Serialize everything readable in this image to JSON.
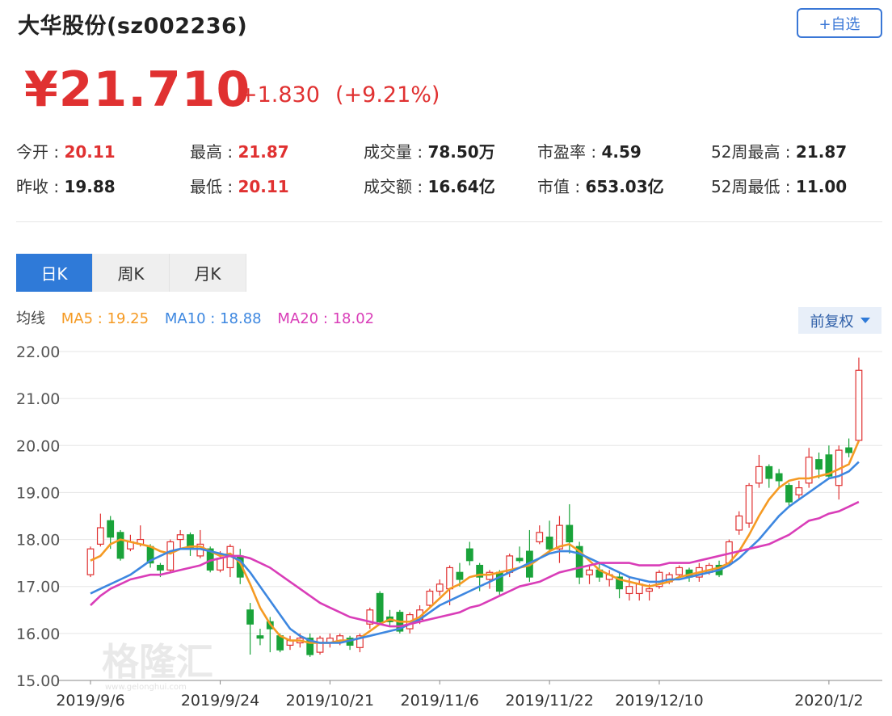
{
  "header": {
    "title": "大华股份(sz002236)",
    "add_label": "+自选"
  },
  "quote": {
    "price": "¥21.710",
    "change": "+1.830",
    "change_pct": "(+9.21%)"
  },
  "stats": {
    "open_label": "今开 : ",
    "open": "20.11",
    "prev_close_label": "昨收 : ",
    "prev_close": "19.88",
    "high_label": "最高 : ",
    "high": "21.87",
    "low_label": "最低 : ",
    "low": "20.11",
    "volume_label": "成交量 : ",
    "volume": "78.50万",
    "amount_label": "成交额 : ",
    "amount": "16.64亿",
    "pe_label": "市盈率 : ",
    "pe": "4.59",
    "mcap_label": "市值 : ",
    "mcap": "653.03亿",
    "w52_high_label": "52周最高 : ",
    "w52_high": "21.87",
    "w52_low_label": "52周最低 : ",
    "w52_low": "11.00"
  },
  "tabs": [
    "日K",
    "周K",
    "月K"
  ],
  "ma": {
    "label": "均线",
    "ma5": "MA5 : 19.25",
    "ma10": "MA10 : 18.88",
    "ma20": "MA20 : 18.02"
  },
  "adjust_label": "前复权",
  "watermark": "格隆汇",
  "watermark_url": "www.gelonghui.com",
  "colors": {
    "up": "#e03131",
    "down": "#1aa33a",
    "ma5": "#f59a23",
    "ma10": "#3d87e0",
    "ma20": "#d93db8",
    "accent": "#2f7ad8"
  },
  "chart_data": {
    "type": "candlestick",
    "ylim": [
      15.0,
      22.0
    ],
    "yticks": [
      "22.00",
      "21.00",
      "20.00",
      "19.00",
      "18.00",
      "17.00",
      "16.00",
      "15.00"
    ],
    "xticks": [
      "2019/9/6",
      "2019/9/24",
      "2019/10/21",
      "2019/11/6",
      "2019/11/22",
      "2019/12/10",
      "2020/1/2"
    ],
    "xtick_index": [
      0,
      13,
      24,
      35,
      46,
      57,
      74
    ],
    "candles": [
      {
        "o": 17.25,
        "c": 17.8,
        "h": 17.85,
        "l": 17.2
      },
      {
        "o": 17.9,
        "c": 18.25,
        "h": 18.55,
        "l": 17.85
      },
      {
        "o": 18.4,
        "c": 18.05,
        "h": 18.5,
        "l": 17.8
      },
      {
        "o": 18.15,
        "c": 17.6,
        "h": 18.2,
        "l": 17.55
      },
      {
        "o": 17.8,
        "c": 17.95,
        "h": 18.1,
        "l": 17.75
      },
      {
        "o": 17.9,
        "c": 18.0,
        "h": 18.3,
        "l": 17.85
      },
      {
        "o": 17.85,
        "c": 17.5,
        "h": 17.9,
        "l": 17.4
      },
      {
        "o": 17.45,
        "c": 17.35,
        "h": 17.5,
        "l": 17.2
      },
      {
        "o": 17.35,
        "c": 17.95,
        "h": 18.0,
        "l": 17.3
      },
      {
        "o": 18.0,
        "c": 18.1,
        "h": 18.2,
        "l": 17.8
      },
      {
        "o": 18.1,
        "c": 17.8,
        "h": 18.15,
        "l": 17.65
      },
      {
        "o": 17.65,
        "c": 17.9,
        "h": 18.2,
        "l": 17.6
      },
      {
        "o": 17.8,
        "c": 17.35,
        "h": 17.85,
        "l": 17.3
      },
      {
        "o": 17.35,
        "c": 17.6,
        "h": 17.75,
        "l": 17.3
      },
      {
        "o": 17.4,
        "c": 17.85,
        "h": 17.9,
        "l": 17.2
      },
      {
        "o": 17.65,
        "c": 17.2,
        "h": 17.8,
        "l": 17.05
      },
      {
        "o": 16.5,
        "c": 16.2,
        "h": 16.65,
        "l": 15.55
      },
      {
        "o": 15.95,
        "c": 15.9,
        "h": 16.1,
        "l": 15.75
      },
      {
        "o": 16.25,
        "c": 16.1,
        "h": 16.35,
        "l": 15.6
      },
      {
        "o": 15.95,
        "c": 15.65,
        "h": 16.0,
        "l": 15.6
      },
      {
        "o": 15.75,
        "c": 15.85,
        "h": 15.95,
        "l": 15.65
      },
      {
        "o": 15.8,
        "c": 15.9,
        "h": 16.0,
        "l": 15.7
      },
      {
        "o": 15.9,
        "c": 15.55,
        "h": 16.0,
        "l": 15.5
      },
      {
        "o": 15.6,
        "c": 15.9,
        "h": 15.95,
        "l": 15.55
      },
      {
        "o": 15.8,
        "c": 15.9,
        "h": 16.0,
        "l": 15.7
      },
      {
        "o": 15.85,
        "c": 15.95,
        "h": 16.0,
        "l": 15.75
      },
      {
        "o": 15.9,
        "c": 15.75,
        "h": 15.95,
        "l": 15.65
      },
      {
        "o": 15.7,
        "c": 15.95,
        "h": 16.0,
        "l": 15.6
      },
      {
        "o": 16.2,
        "c": 16.5,
        "h": 16.55,
        "l": 16.1
      },
      {
        "o": 16.85,
        "c": 16.25,
        "h": 16.9,
        "l": 16.2
      },
      {
        "o": 16.35,
        "c": 16.25,
        "h": 16.5,
        "l": 16.15
      },
      {
        "o": 16.45,
        "c": 16.05,
        "h": 16.5,
        "l": 16.0
      },
      {
        "o": 16.1,
        "c": 16.4,
        "h": 16.45,
        "l": 16.0
      },
      {
        "o": 16.3,
        "c": 16.5,
        "h": 16.6,
        "l": 16.2
      },
      {
        "o": 16.6,
        "c": 16.9,
        "h": 16.95,
        "l": 16.55
      },
      {
        "o": 16.9,
        "c": 17.05,
        "h": 17.15,
        "l": 16.8
      },
      {
        "o": 16.95,
        "c": 17.4,
        "h": 17.45,
        "l": 16.6
      },
      {
        "o": 17.3,
        "c": 17.15,
        "h": 17.5,
        "l": 17.0
      },
      {
        "o": 17.8,
        "c": 17.55,
        "h": 17.95,
        "l": 17.45
      },
      {
        "o": 17.45,
        "c": 17.2,
        "h": 17.5,
        "l": 16.9
      },
      {
        "o": 17.15,
        "c": 17.3,
        "h": 17.35,
        "l": 16.95
      },
      {
        "o": 17.3,
        "c": 16.9,
        "h": 17.35,
        "l": 16.8
      },
      {
        "o": 17.3,
        "c": 17.65,
        "h": 17.7,
        "l": 17.2
      },
      {
        "o": 17.6,
        "c": 17.55,
        "h": 17.85,
        "l": 17.5
      },
      {
        "o": 17.75,
        "c": 17.2,
        "h": 18.2,
        "l": 17.1
      },
      {
        "o": 17.95,
        "c": 18.15,
        "h": 18.3,
        "l": 17.9
      },
      {
        "o": 18.05,
        "c": 17.8,
        "h": 18.4,
        "l": 17.7
      },
      {
        "o": 17.8,
        "c": 18.3,
        "h": 18.5,
        "l": 17.5
      },
      {
        "o": 18.3,
        "c": 17.95,
        "h": 18.75,
        "l": 17.7
      },
      {
        "o": 17.85,
        "c": 17.2,
        "h": 17.95,
        "l": 17.05
      },
      {
        "o": 17.25,
        "c": 17.35,
        "h": 17.45,
        "l": 17.05
      },
      {
        "o": 17.35,
        "c": 17.2,
        "h": 17.5,
        "l": 17.1
      },
      {
        "o": 17.15,
        "c": 17.25,
        "h": 17.35,
        "l": 17.0
      },
      {
        "o": 17.2,
        "c": 16.95,
        "h": 17.3,
        "l": 16.75
      },
      {
        "o": 16.85,
        "c": 17.0,
        "h": 17.2,
        "l": 16.7
      },
      {
        "o": 16.85,
        "c": 17.05,
        "h": 17.15,
        "l": 16.7
      },
      {
        "o": 16.9,
        "c": 16.95,
        "h": 17.05,
        "l": 16.7
      },
      {
        "o": 17.0,
        "c": 17.3,
        "h": 17.35,
        "l": 16.95
      },
      {
        "o": 17.1,
        "c": 17.25,
        "h": 17.3,
        "l": 17.05
      },
      {
        "o": 17.25,
        "c": 17.4,
        "h": 17.45,
        "l": 17.2
      },
      {
        "o": 17.35,
        "c": 17.2,
        "h": 17.4,
        "l": 17.1
      },
      {
        "o": 17.2,
        "c": 17.4,
        "h": 17.5,
        "l": 17.1
      },
      {
        "o": 17.3,
        "c": 17.45,
        "h": 17.5,
        "l": 17.25
      },
      {
        "o": 17.45,
        "c": 17.25,
        "h": 17.55,
        "l": 17.2
      },
      {
        "o": 17.5,
        "c": 17.95,
        "h": 18.0,
        "l": 17.45
      },
      {
        "o": 18.2,
        "c": 18.5,
        "h": 18.6,
        "l": 18.1
      },
      {
        "o": 18.35,
        "c": 19.15,
        "h": 19.2,
        "l": 18.25
      },
      {
        "o": 19.2,
        "c": 19.55,
        "h": 19.8,
        "l": 19.1
      },
      {
        "o": 19.55,
        "c": 19.3,
        "h": 19.6,
        "l": 19.1
      },
      {
        "o": 19.4,
        "c": 19.25,
        "h": 19.5,
        "l": 19.1
      },
      {
        "o": 19.15,
        "c": 18.8,
        "h": 19.2,
        "l": 18.7
      },
      {
        "o": 18.95,
        "c": 19.1,
        "h": 19.25,
        "l": 18.85
      },
      {
        "o": 19.2,
        "c": 19.75,
        "h": 19.95,
        "l": 19.1
      },
      {
        "o": 19.7,
        "c": 19.5,
        "h": 19.85,
        "l": 19.3
      },
      {
        "o": 19.8,
        "c": 19.35,
        "h": 20.0,
        "l": 19.3
      },
      {
        "o": 19.15,
        "c": 19.9,
        "h": 20.0,
        "l": 18.85
      },
      {
        "o": 19.95,
        "c": 19.85,
        "h": 20.15,
        "l": 19.75
      },
      {
        "o": 20.11,
        "c": 21.6,
        "h": 21.87,
        "l": 20.11
      }
    ],
    "ma5": [
      17.55,
      17.65,
      17.9,
      18.0,
      17.95,
      17.9,
      17.85,
      17.75,
      17.7,
      17.8,
      17.85,
      17.85,
      17.75,
      17.65,
      17.7,
      17.5,
      17.05,
      16.55,
      16.2,
      15.95,
      15.85,
      15.85,
      15.8,
      15.8,
      15.8,
      15.85,
      15.85,
      15.9,
      16.05,
      16.2,
      16.3,
      16.25,
      16.25,
      16.35,
      16.55,
      16.75,
      16.95,
      17.05,
      17.2,
      17.25,
      17.25,
      17.3,
      17.35,
      17.4,
      17.45,
      17.6,
      17.75,
      17.85,
      17.9,
      17.75,
      17.55,
      17.35,
      17.25,
      17.15,
      17.1,
      17.05,
      17.0,
      17.05,
      17.1,
      17.2,
      17.25,
      17.3,
      17.35,
      17.4,
      17.5,
      17.75,
      18.1,
      18.5,
      18.85,
      19.1,
      19.25,
      19.3,
      19.3,
      19.35,
      19.4,
      19.5,
      19.6,
      20.1
    ],
    "ma10": [
      16.85,
      16.95,
      17.05,
      17.15,
      17.25,
      17.4,
      17.55,
      17.65,
      17.75,
      17.8,
      17.8,
      17.8,
      17.75,
      17.7,
      17.65,
      17.55,
      17.3,
      17.0,
      16.7,
      16.4,
      16.1,
      15.95,
      15.85,
      15.8,
      15.8,
      15.8,
      15.85,
      15.9,
      15.95,
      16.0,
      16.05,
      16.1,
      16.2,
      16.3,
      16.45,
      16.6,
      16.7,
      16.8,
      16.9,
      17.0,
      17.1,
      17.2,
      17.3,
      17.4,
      17.5,
      17.6,
      17.7,
      17.75,
      17.75,
      17.7,
      17.6,
      17.5,
      17.4,
      17.3,
      17.2,
      17.15,
      17.1,
      17.1,
      17.15,
      17.15,
      17.2,
      17.25,
      17.3,
      17.35,
      17.45,
      17.6,
      17.8,
      18.0,
      18.25,
      18.5,
      18.7,
      18.85,
      19.0,
      19.15,
      19.3,
      19.35,
      19.45,
      19.65
    ],
    "ma20": [
      16.6,
      16.8,
      16.95,
      17.05,
      17.15,
      17.2,
      17.25,
      17.25,
      17.3,
      17.35,
      17.4,
      17.45,
      17.55,
      17.6,
      17.65,
      17.65,
      17.6,
      17.5,
      17.4,
      17.25,
      17.1,
      16.95,
      16.8,
      16.65,
      16.55,
      16.45,
      16.35,
      16.3,
      16.25,
      16.2,
      16.15,
      16.15,
      16.2,
      16.25,
      16.3,
      16.35,
      16.4,
      16.45,
      16.55,
      16.6,
      16.7,
      16.8,
      16.9,
      17.0,
      17.05,
      17.1,
      17.2,
      17.3,
      17.35,
      17.4,
      17.45,
      17.5,
      17.5,
      17.5,
      17.5,
      17.45,
      17.45,
      17.45,
      17.5,
      17.5,
      17.5,
      17.55,
      17.6,
      17.65,
      17.7,
      17.75,
      17.8,
      17.85,
      17.9,
      18.0,
      18.1,
      18.25,
      18.4,
      18.45,
      18.55,
      18.6,
      18.7,
      18.8
    ]
  }
}
